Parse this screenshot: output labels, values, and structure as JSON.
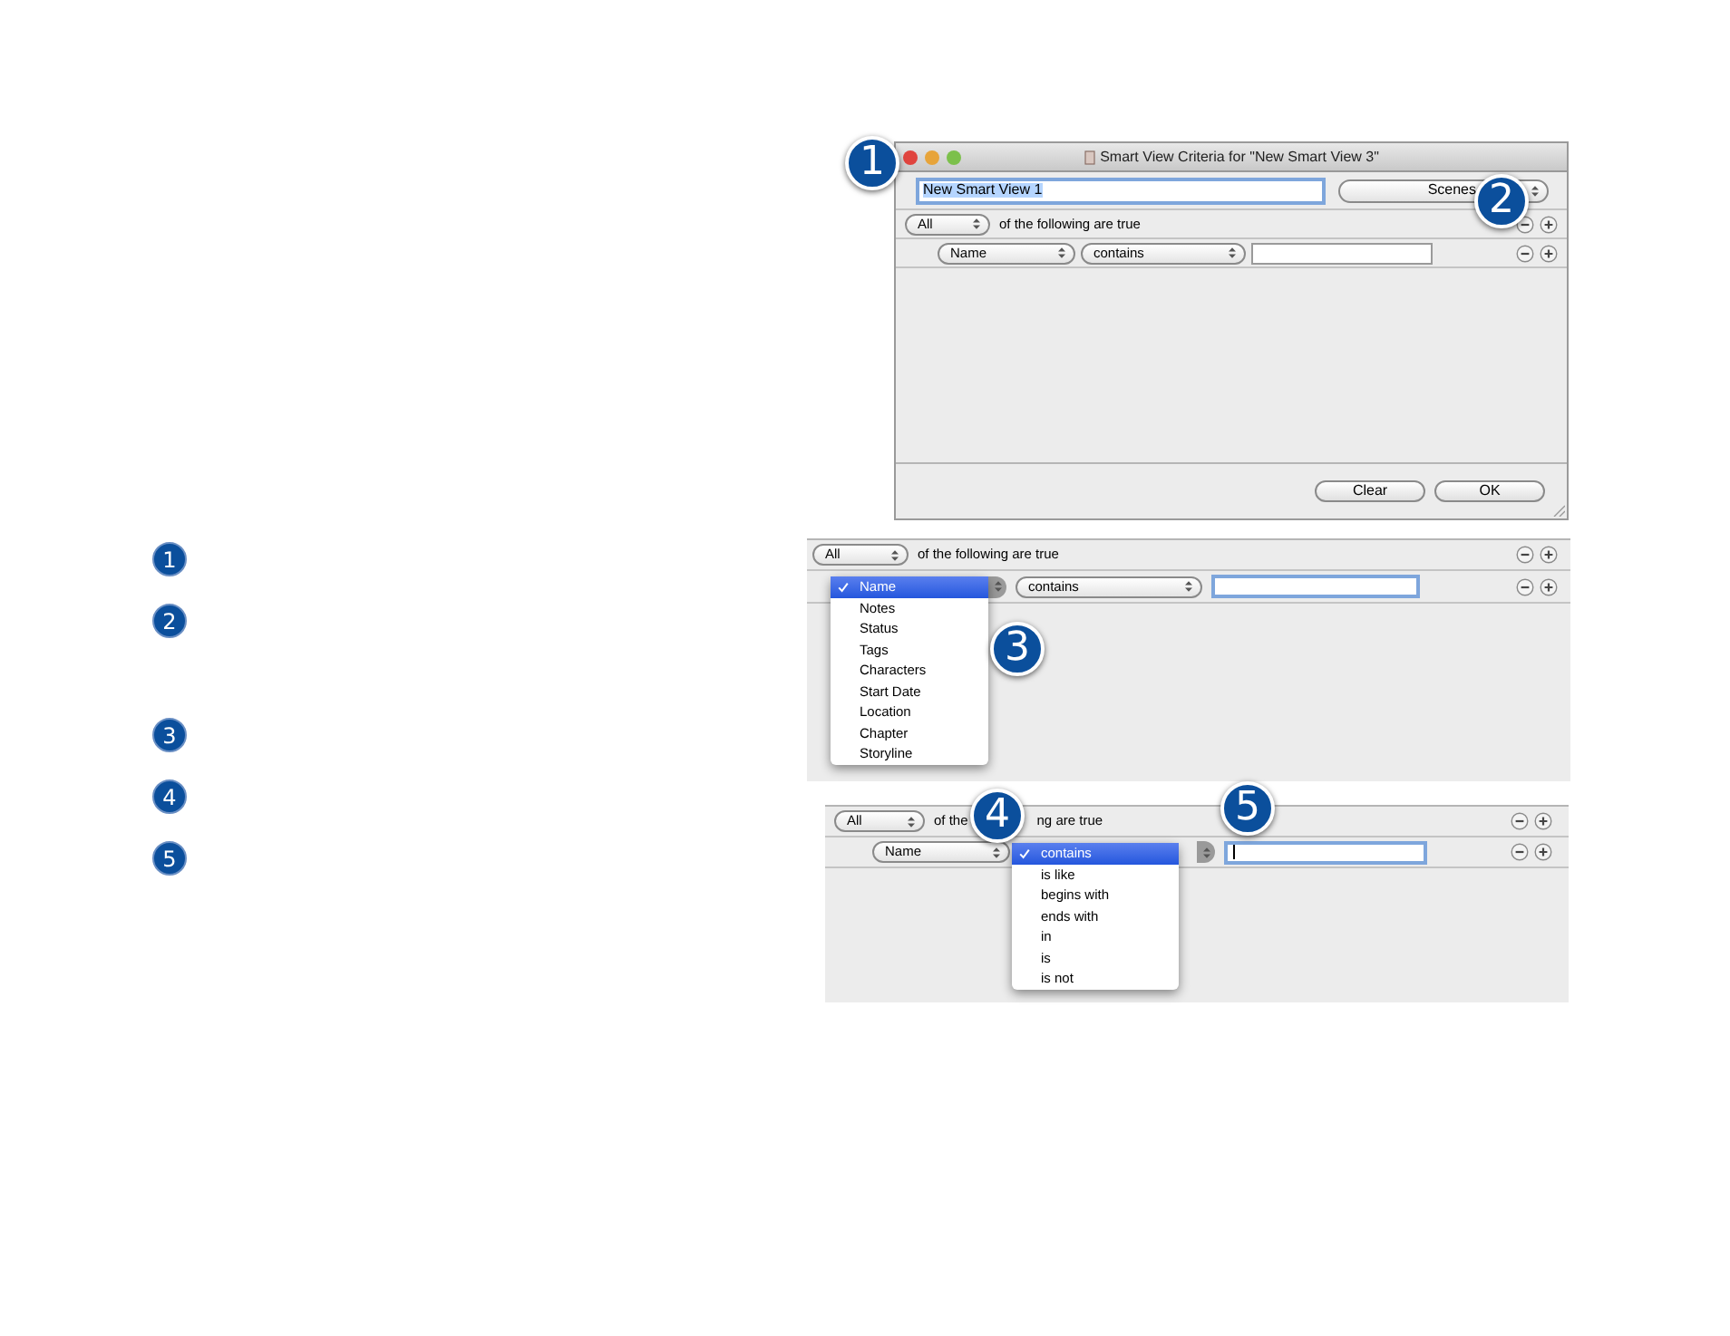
{
  "window": {
    "title": "Smart View Criteria for \"New Smart View 3\"",
    "name_field": {
      "value": "New Smart View 1"
    },
    "scope": "Scenes",
    "match": "All",
    "match_text": "of the following are true",
    "criteria": [
      {
        "field": "Name",
        "operator": "contains"
      }
    ],
    "buttons": [
      "Clear",
      "OK"
    ]
  },
  "field_menu_panel": {
    "match": "All",
    "match_text": "of the following are true",
    "operator": "contains",
    "menu": [
      {
        "label": "Name",
        "selected": true
      },
      {
        "label": "Notes",
        "selected": false
      },
      {
        "label": "Status",
        "selected": false
      },
      {
        "label": "Tags",
        "selected": false
      },
      {
        "label": "Characters",
        "selected": false
      },
      {
        "label": "Start Date",
        "selected": false
      },
      {
        "label": "Location",
        "selected": false
      },
      {
        "label": "Chapter",
        "selected": false
      },
      {
        "label": "Storyline",
        "selected": false
      }
    ]
  },
  "operator_menu_panel": {
    "match": "All",
    "match_text_start": "of the",
    "match_text_end": "ng are true",
    "field": "Name",
    "menu": [
      {
        "label": "contains",
        "selected": true
      },
      {
        "label": "is like",
        "selected": false
      },
      {
        "label": "begins with",
        "selected": false
      },
      {
        "label": "ends with",
        "selected": false
      },
      {
        "label": "in",
        "selected": false
      },
      {
        "label": "is",
        "selected": false
      },
      {
        "label": "is not",
        "selected": false
      }
    ]
  },
  "callouts": [
    "1",
    "2",
    "3",
    "4",
    "5"
  ],
  "legend": [
    "1",
    "2",
    "3",
    "4",
    "5"
  ]
}
